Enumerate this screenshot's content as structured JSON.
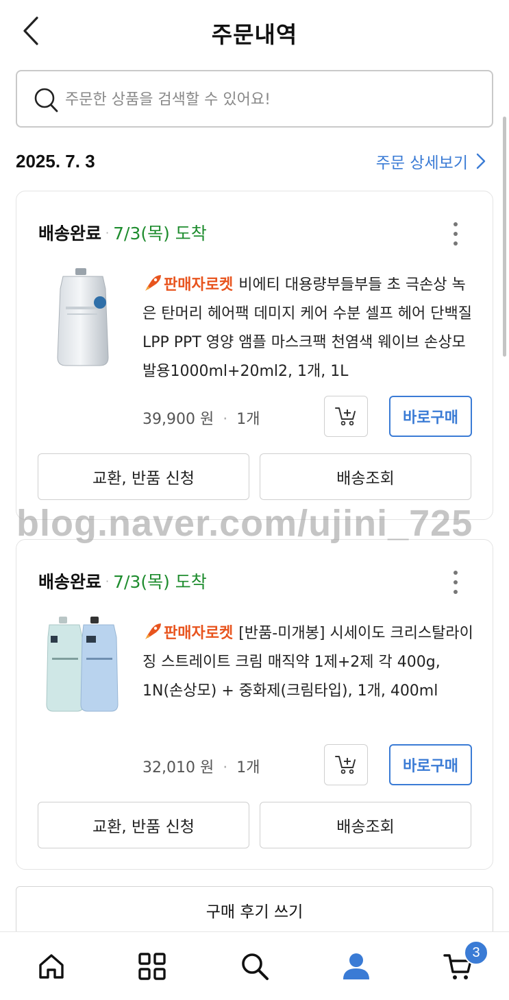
{
  "header": {
    "title": "주문내역"
  },
  "search": {
    "placeholder": "주문한 상품을 검색할 수 있어요!"
  },
  "order": {
    "date": "2025. 7. 3",
    "detail_link": "주문 상세보기"
  },
  "items": [
    {
      "status": "배송완료",
      "arrival": "7/3(목) 도착",
      "badge": "판매자로켓",
      "title": "비에티 대용량부들부들 초 극손상 녹은 탄머리 헤어팩 데미지 케어 수분 셀프 헤어 단백질 LPP PPT 영양 앰플 마스크팩 천염색 웨이브 손상모발용1000ml+20ml2, 1개, 1L",
      "price": "39,900 원",
      "quantity": "1개",
      "buy_label": "바로구매",
      "exchange_label": "교환, 반품 신청",
      "tracking_label": "배송조회"
    },
    {
      "status": "배송완료",
      "arrival": "7/3(목) 도착",
      "badge": "판매자로켓",
      "title": "[반품-미개봉] 시세이도 크리스탈라이징 스트레이트 크림 매직약 1제+2제 각 400g, 1N(손상모) + 중화제(크림타입), 1개, 400ml",
      "price": "32,010 원",
      "quantity": "1개",
      "buy_label": "바로구매",
      "exchange_label": "교환, 반품 신청",
      "tracking_label": "배송조회"
    }
  ],
  "watermark": "blog.naver.com/ujini_725",
  "review_button": "구매 후기 쓰기",
  "bottom_nav": {
    "items": [
      "home-icon",
      "categories-icon",
      "search-icon",
      "my-page-icon",
      "cart-icon"
    ],
    "cart_count": "3"
  },
  "colors": {
    "accent": "#3a7bd5",
    "arrival": "#1e8c2e",
    "badge": "#e8541e"
  }
}
